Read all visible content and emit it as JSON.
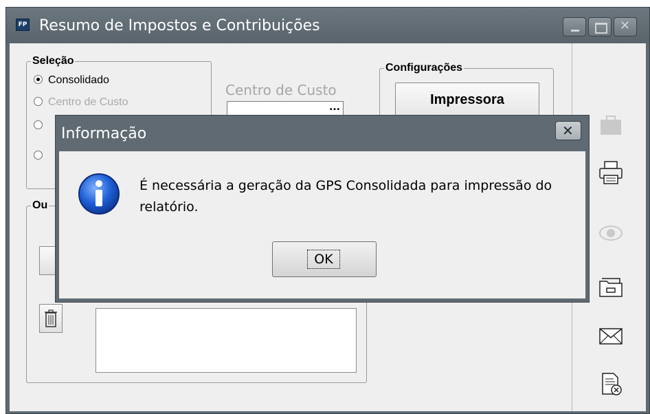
{
  "window": {
    "icon_text": "FP",
    "title": "Resumo de Impostos e Contribuições"
  },
  "selecao": {
    "label": "Seleção",
    "options": [
      "Consolidado",
      "Centro de Custo"
    ]
  },
  "centro_custo": {
    "label": "Centro de Custo",
    "lookup": "..."
  },
  "configuracoes": {
    "label": "Configurações",
    "impressora": "Impressora"
  },
  "outros": {
    "label": "Ou"
  },
  "dialog": {
    "title": "Informação",
    "message": "É necessária a geração da GPS Consolidada para impressão do relatório.",
    "ok": "OK"
  },
  "side_icons": [
    "briefcase-icon",
    "printer-icon",
    "preview-eye-icon",
    "folder-icon",
    "mail-icon",
    "cancel-document-icon"
  ]
}
